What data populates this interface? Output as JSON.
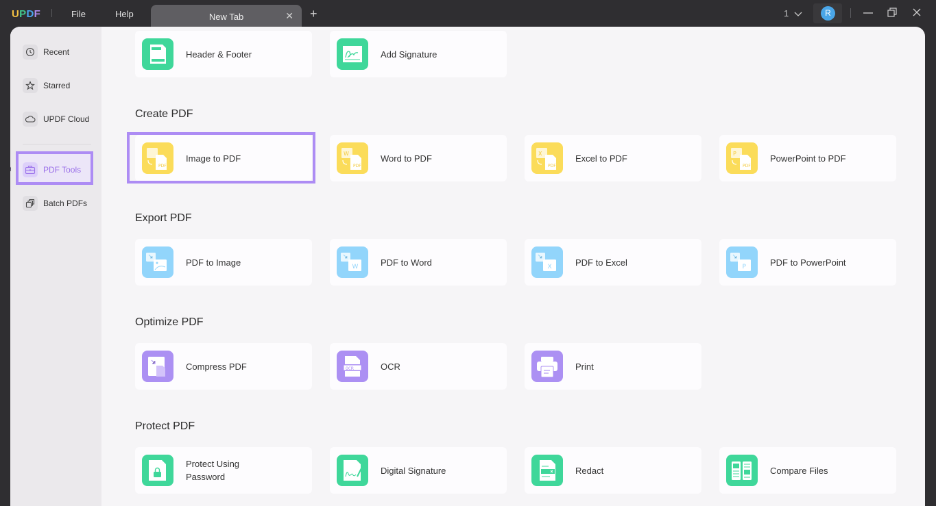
{
  "titlebar": {
    "logo": {
      "u": "U",
      "p": "P",
      "d": "D",
      "f": "F"
    },
    "menu": [
      "File",
      "Help"
    ],
    "tab": {
      "label": "New Tab"
    },
    "page_count": "1",
    "avatar_initial": "R"
  },
  "colors": {
    "accent": "#ad8cf4",
    "green": "#3fd79a",
    "yellow": "#fbdc5a",
    "blue": "#92d5fb",
    "purple": "#ac90f3"
  },
  "sidebar": {
    "items": [
      {
        "label": "Recent",
        "icon": "clock-icon"
      },
      {
        "label": "Starred",
        "icon": "star-icon"
      },
      {
        "label": "UPDF Cloud",
        "icon": "cloud-icon"
      },
      {
        "label": "PDF Tools",
        "icon": "toolbox-icon",
        "active": true
      },
      {
        "label": "Batch PDFs",
        "icon": "batch-icon"
      }
    ]
  },
  "sections": {
    "top": {
      "items": [
        {
          "label": "Header & Footer"
        },
        {
          "label": "Add Signature"
        }
      ]
    },
    "create": {
      "title": "Create PDF",
      "items": [
        {
          "label": "Image to PDF",
          "selected": true
        },
        {
          "label": "Word to PDF"
        },
        {
          "label": "Excel to PDF"
        },
        {
          "label": "PowerPoint to PDF"
        }
      ]
    },
    "export": {
      "title": "Export PDF",
      "items": [
        {
          "label": "PDF to Image"
        },
        {
          "label": "PDF to Word"
        },
        {
          "label": "PDF to Excel"
        },
        {
          "label": "PDF to PowerPoint"
        }
      ]
    },
    "optimize": {
      "title": "Optimize PDF",
      "items": [
        {
          "label": "Compress PDF"
        },
        {
          "label": "OCR"
        },
        {
          "label": "Print"
        }
      ]
    },
    "protect": {
      "title": "Protect PDF",
      "items": [
        {
          "label": "Protect Using Password"
        },
        {
          "label": "Digital Signature"
        },
        {
          "label": "Redact"
        },
        {
          "label": "Compare Files"
        }
      ]
    }
  },
  "icon_glyphs": {
    "word": "W",
    "excel": "X",
    "ppt": "P",
    "pdf": "PDF",
    "ocr": "OCR"
  }
}
